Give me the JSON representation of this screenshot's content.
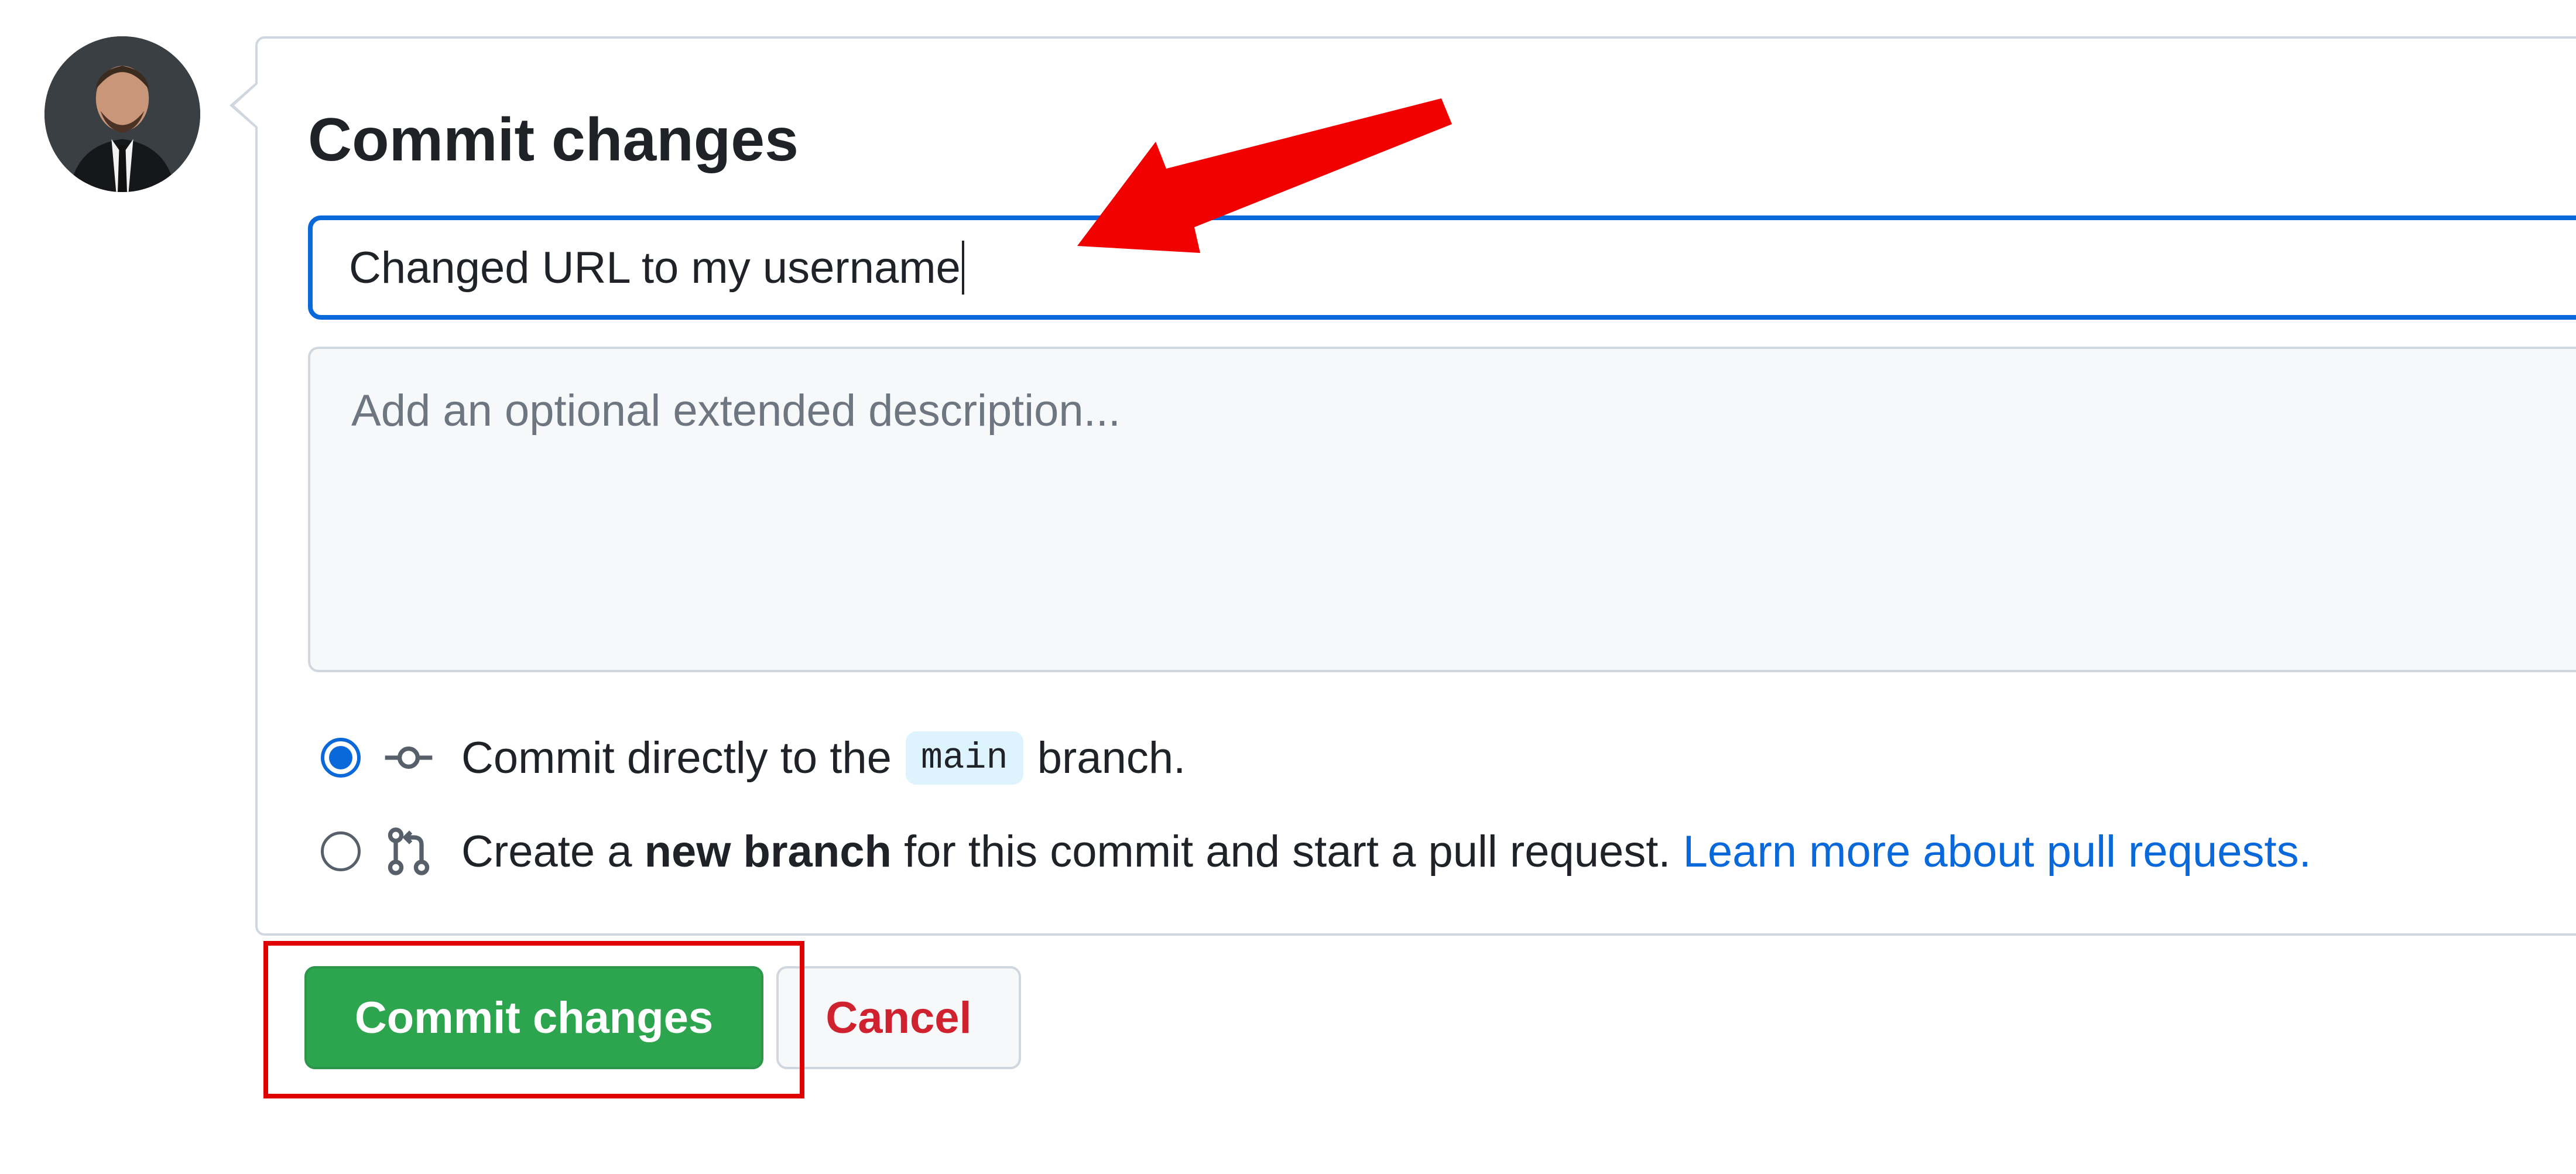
{
  "dialog": {
    "title": "Commit changes"
  },
  "summary": {
    "value": "Changed URL to my username"
  },
  "description": {
    "placeholder": "Add an optional extended description..."
  },
  "options": {
    "direct": {
      "prefix": "Commit directly to the",
      "branch": "main",
      "suffix": "branch.",
      "selected": true,
      "icon": "git-commit-icon"
    },
    "new_branch": {
      "prefix": "Create a",
      "bold": "new branch",
      "middle": "for this commit and start a pull request.",
      "link": "Learn more about pull requests.",
      "selected": false,
      "icon": "git-pull-request-icon"
    }
  },
  "buttons": {
    "commit": "Commit changes",
    "cancel": "Cancel"
  },
  "colors": {
    "accent": "#0969da",
    "commit_button": "#2da44e",
    "cancel_text": "#cf222e",
    "annotation": "#e00000"
  }
}
